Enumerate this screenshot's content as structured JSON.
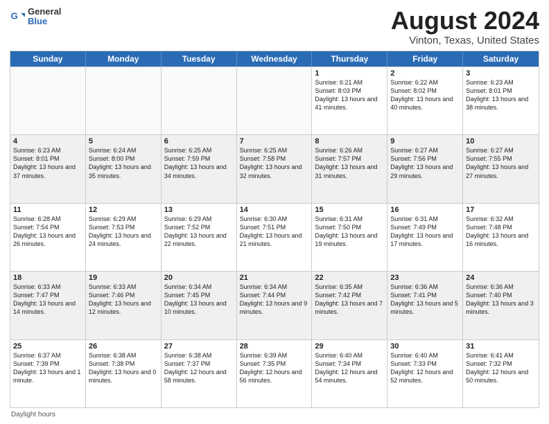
{
  "logo": {
    "general": "General",
    "blue": "Blue"
  },
  "title": {
    "month_year": "August 2024",
    "location": "Vinton, Texas, United States"
  },
  "days_of_week": [
    "Sunday",
    "Monday",
    "Tuesday",
    "Wednesday",
    "Thursday",
    "Friday",
    "Saturday"
  ],
  "footer": {
    "note": "Daylight hours"
  },
  "weeks": [
    [
      {
        "day": "",
        "info": "",
        "empty": true
      },
      {
        "day": "",
        "info": "",
        "empty": true
      },
      {
        "day": "",
        "info": "",
        "empty": true
      },
      {
        "day": "",
        "info": "",
        "empty": true
      },
      {
        "day": "1",
        "info": "Sunrise: 6:21 AM\nSunset: 8:03 PM\nDaylight: 13 hours\nand 41 minutes."
      },
      {
        "day": "2",
        "info": "Sunrise: 6:22 AM\nSunset: 8:02 PM\nDaylight: 13 hours\nand 40 minutes."
      },
      {
        "day": "3",
        "info": "Sunrise: 6:23 AM\nSunset: 8:01 PM\nDaylight: 13 hours\nand 38 minutes."
      }
    ],
    [
      {
        "day": "4",
        "info": "Sunrise: 6:23 AM\nSunset: 8:01 PM\nDaylight: 13 hours\nand 37 minutes.",
        "shaded": true
      },
      {
        "day": "5",
        "info": "Sunrise: 6:24 AM\nSunset: 8:00 PM\nDaylight: 13 hours\nand 35 minutes.",
        "shaded": true
      },
      {
        "day": "6",
        "info": "Sunrise: 6:25 AM\nSunset: 7:59 PM\nDaylight: 13 hours\nand 34 minutes.",
        "shaded": true
      },
      {
        "day": "7",
        "info": "Sunrise: 6:25 AM\nSunset: 7:58 PM\nDaylight: 13 hours\nand 32 minutes.",
        "shaded": true
      },
      {
        "day": "8",
        "info": "Sunrise: 6:26 AM\nSunset: 7:57 PM\nDaylight: 13 hours\nand 31 minutes.",
        "shaded": true
      },
      {
        "day": "9",
        "info": "Sunrise: 6:27 AM\nSunset: 7:56 PM\nDaylight: 13 hours\nand 29 minutes.",
        "shaded": true
      },
      {
        "day": "10",
        "info": "Sunrise: 6:27 AM\nSunset: 7:55 PM\nDaylight: 13 hours\nand 27 minutes.",
        "shaded": true
      }
    ],
    [
      {
        "day": "11",
        "info": "Sunrise: 6:28 AM\nSunset: 7:54 PM\nDaylight: 13 hours\nand 26 minutes."
      },
      {
        "day": "12",
        "info": "Sunrise: 6:29 AM\nSunset: 7:53 PM\nDaylight: 13 hours\nand 24 minutes."
      },
      {
        "day": "13",
        "info": "Sunrise: 6:29 AM\nSunset: 7:52 PM\nDaylight: 13 hours\nand 22 minutes."
      },
      {
        "day": "14",
        "info": "Sunrise: 6:30 AM\nSunset: 7:51 PM\nDaylight: 13 hours\nand 21 minutes."
      },
      {
        "day": "15",
        "info": "Sunrise: 6:31 AM\nSunset: 7:50 PM\nDaylight: 13 hours\nand 19 minutes."
      },
      {
        "day": "16",
        "info": "Sunrise: 6:31 AM\nSunset: 7:49 PM\nDaylight: 13 hours\nand 17 minutes."
      },
      {
        "day": "17",
        "info": "Sunrise: 6:32 AM\nSunset: 7:48 PM\nDaylight: 13 hours\nand 16 minutes."
      }
    ],
    [
      {
        "day": "18",
        "info": "Sunrise: 6:33 AM\nSunset: 7:47 PM\nDaylight: 13 hours\nand 14 minutes.",
        "shaded": true
      },
      {
        "day": "19",
        "info": "Sunrise: 6:33 AM\nSunset: 7:46 PM\nDaylight: 13 hours\nand 12 minutes.",
        "shaded": true
      },
      {
        "day": "20",
        "info": "Sunrise: 6:34 AM\nSunset: 7:45 PM\nDaylight: 13 hours\nand 10 minutes.",
        "shaded": true
      },
      {
        "day": "21",
        "info": "Sunrise: 6:34 AM\nSunset: 7:44 PM\nDaylight: 13 hours\nand 9 minutes.",
        "shaded": true
      },
      {
        "day": "22",
        "info": "Sunrise: 6:35 AM\nSunset: 7:42 PM\nDaylight: 13 hours\nand 7 minutes.",
        "shaded": true
      },
      {
        "day": "23",
        "info": "Sunrise: 6:36 AM\nSunset: 7:41 PM\nDaylight: 13 hours\nand 5 minutes.",
        "shaded": true
      },
      {
        "day": "24",
        "info": "Sunrise: 6:36 AM\nSunset: 7:40 PM\nDaylight: 13 hours\nand 3 minutes.",
        "shaded": true
      }
    ],
    [
      {
        "day": "25",
        "info": "Sunrise: 6:37 AM\nSunset: 7:39 PM\nDaylight: 13 hours\nand 1 minute."
      },
      {
        "day": "26",
        "info": "Sunrise: 6:38 AM\nSunset: 7:38 PM\nDaylight: 13 hours\nand 0 minutes."
      },
      {
        "day": "27",
        "info": "Sunrise: 6:38 AM\nSunset: 7:37 PM\nDaylight: 12 hours\nand 58 minutes."
      },
      {
        "day": "28",
        "info": "Sunrise: 6:39 AM\nSunset: 7:35 PM\nDaylight: 12 hours\nand 56 minutes."
      },
      {
        "day": "29",
        "info": "Sunrise: 6:40 AM\nSunset: 7:34 PM\nDaylight: 12 hours\nand 54 minutes."
      },
      {
        "day": "30",
        "info": "Sunrise: 6:40 AM\nSunset: 7:33 PM\nDaylight: 12 hours\nand 52 minutes."
      },
      {
        "day": "31",
        "info": "Sunrise: 6:41 AM\nSunset: 7:32 PM\nDaylight: 12 hours\nand 50 minutes."
      }
    ]
  ]
}
